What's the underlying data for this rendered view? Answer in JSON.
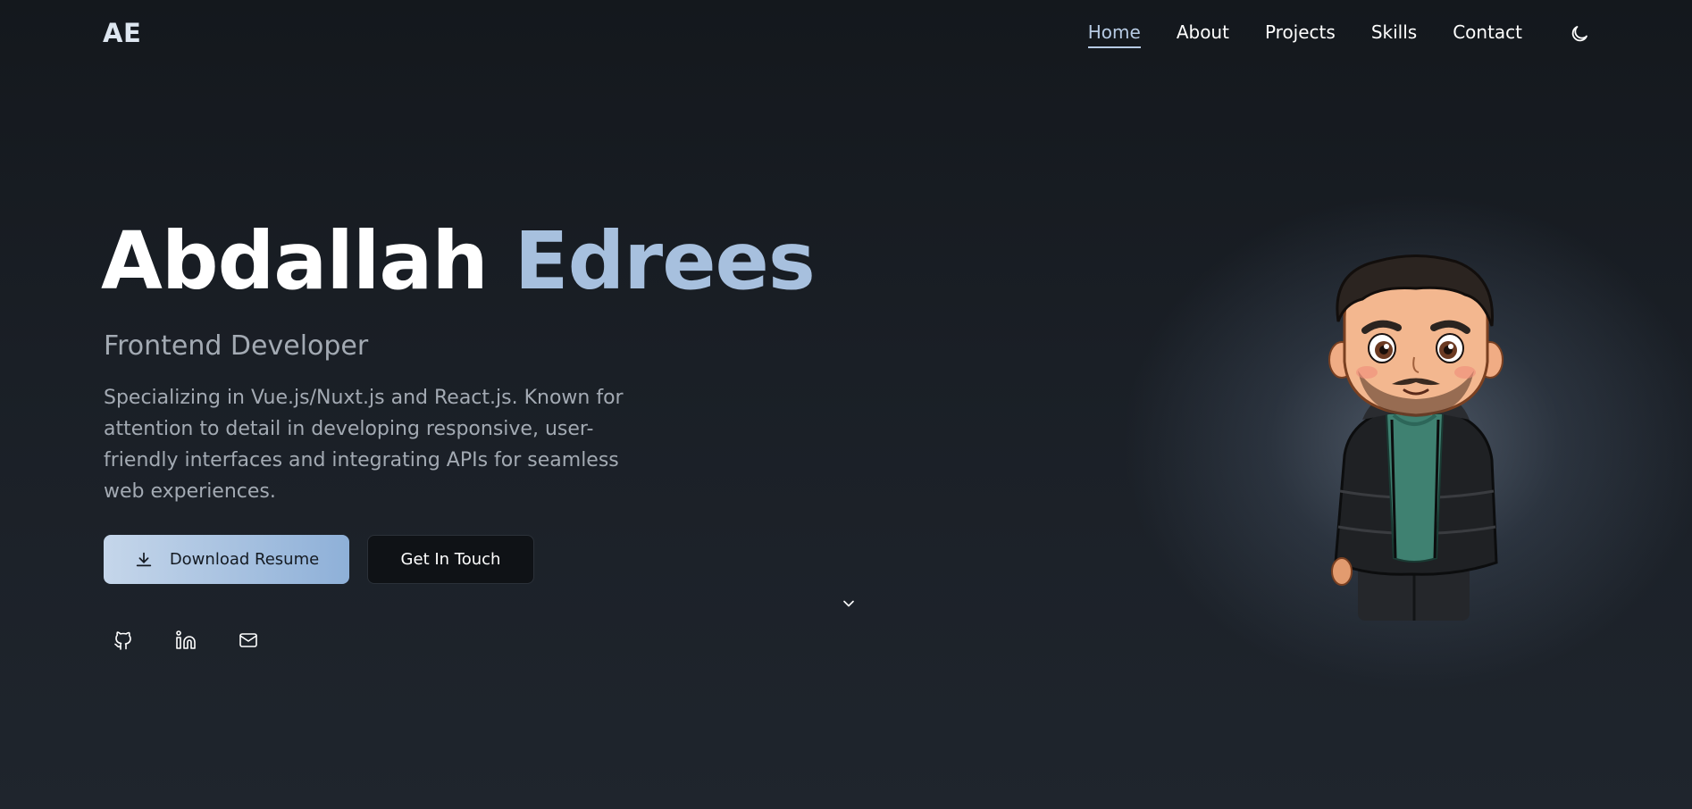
{
  "header": {
    "logo": "AE",
    "nav": [
      {
        "label": "Home",
        "active": true
      },
      {
        "label": "About",
        "active": false
      },
      {
        "label": "Projects",
        "active": false
      },
      {
        "label": "Skills",
        "active": false
      },
      {
        "label": "Contact",
        "active": false
      }
    ],
    "theme_icon": "moon-icon"
  },
  "hero": {
    "first_name": "Abdallah",
    "last_name": "Edrees",
    "subtitle": "Frontend Developer",
    "description": "Specializing in Vue.js/Nuxt.js and React.js. Known for attention to detail in developing responsive, user-friendly interfaces and integrating APIs for seamless web experiences.",
    "primary_button": "Download Resume",
    "primary_button_icon": "download-icon",
    "secondary_button": "Get In Touch",
    "scroll_icon": "chevron-down-icon",
    "socials": [
      "github-icon",
      "linkedin-icon",
      "mail-icon"
    ]
  },
  "colors": {
    "accent": "#a7c0de",
    "background": "#1a1f26",
    "text_muted": "#a3aab3"
  }
}
